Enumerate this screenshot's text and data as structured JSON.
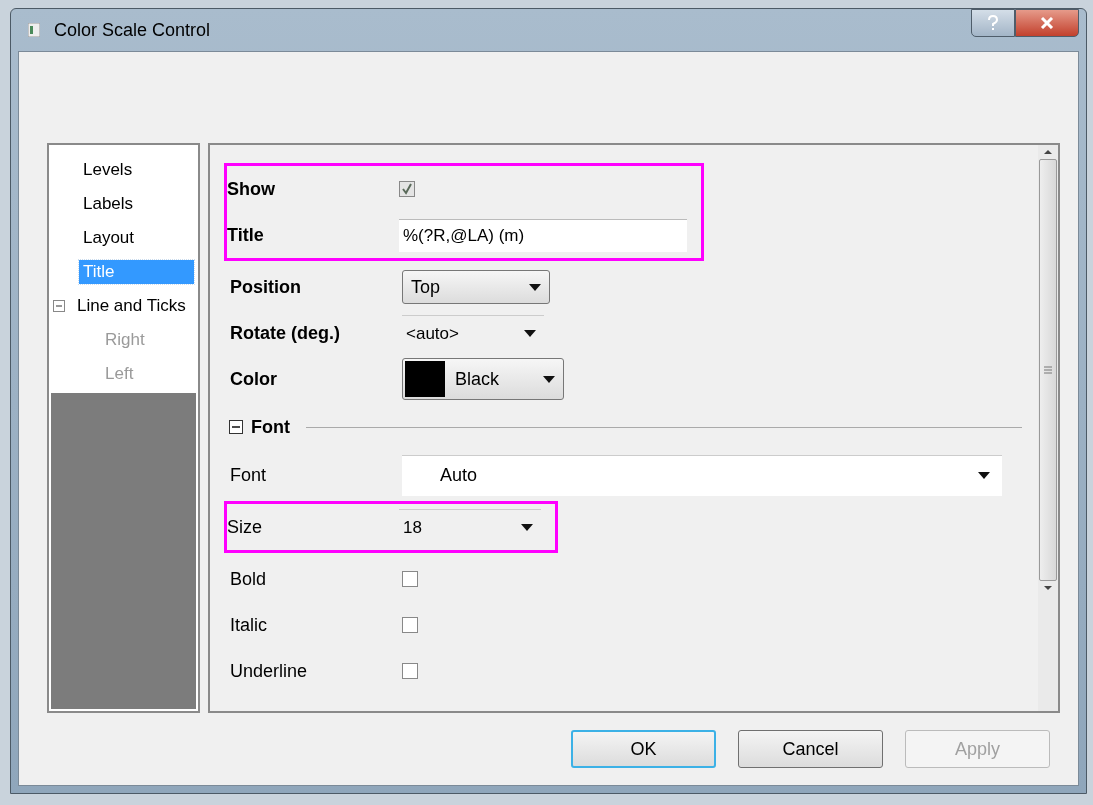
{
  "window": {
    "title": "Color Scale Control"
  },
  "tree": [
    {
      "label": "Levels",
      "selected": false,
      "disabled": false
    },
    {
      "label": "Labels",
      "selected": false,
      "disabled": false
    },
    {
      "label": "Layout",
      "selected": false,
      "disabled": false
    },
    {
      "label": "Title",
      "selected": true,
      "disabled": false
    },
    {
      "label": "Line and Ticks",
      "selected": false,
      "disabled": false,
      "expanded": true,
      "children": [
        {
          "label": "Right",
          "selected": false,
          "disabled": true
        },
        {
          "label": "Left",
          "selected": false,
          "disabled": true
        }
      ]
    }
  ],
  "properties": {
    "groups": [
      {
        "highlighted": true,
        "rows": [
          {
            "kind": "checkbox",
            "label": "Show",
            "checked": true,
            "disabled": true
          },
          {
            "kind": "text",
            "label": "Title",
            "value": "%(?R,@LA) (m)"
          }
        ]
      },
      {
        "highlighted": false,
        "rows": [
          {
            "kind": "combo",
            "label": "Position",
            "value": "Top"
          },
          {
            "kind": "dropdown",
            "label": "Rotate (deg.)",
            "value": "<auto>"
          },
          {
            "kind": "color",
            "label": "Color",
            "value": "Black",
            "color": "#000000"
          }
        ]
      }
    ],
    "font_section": {
      "label": "Font",
      "expanded": true,
      "groups": [
        {
          "highlighted": false,
          "rows": [
            {
              "kind": "wide",
              "label": "Font",
              "value": "Auto"
            }
          ]
        },
        {
          "highlighted": true,
          "rows": [
            {
              "kind": "dropdown",
              "label": "Size",
              "value": "18"
            }
          ]
        },
        {
          "highlighted": false,
          "rows": [
            {
              "kind": "checkbox",
              "label": "Bold",
              "checked": false,
              "disabled": false
            },
            {
              "kind": "checkbox",
              "label": "Italic",
              "checked": false,
              "disabled": false
            },
            {
              "kind": "checkbox",
              "label": "Underline",
              "checked": false,
              "disabled": false
            }
          ]
        }
      ]
    }
  },
  "buttons": [
    {
      "label": "OK",
      "default": true,
      "disabled": false
    },
    {
      "label": "Cancel",
      "default": false,
      "disabled": false
    },
    {
      "label": "Apply",
      "default": false,
      "disabled": true
    }
  ]
}
